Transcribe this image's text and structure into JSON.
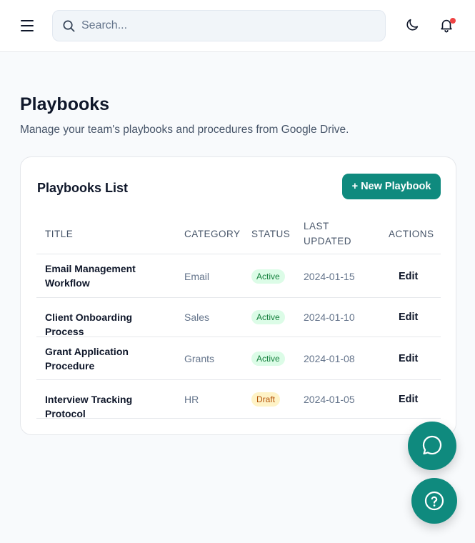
{
  "header": {
    "search_placeholder": "Search..."
  },
  "icons": {
    "menu": "menu-icon",
    "search": "search-icon",
    "theme": "moon-icon",
    "notifications": "bell-icon",
    "chat": "chat-bubble-icon",
    "help": "help-circle-icon"
  },
  "colors": {
    "accent": "#0f8a7e",
    "notification_dot": "#ef4444",
    "active_badge_bg": "#dcfce7",
    "active_badge_text": "#15803d",
    "draft_badge_bg": "#fef3c7",
    "draft_badge_text": "#b45309"
  },
  "page": {
    "title": "Playbooks",
    "subtitle": "Manage your team's playbooks and procedures from Google Drive."
  },
  "card": {
    "title": "Playbooks List",
    "new_button_label": "+ New Playbook"
  },
  "table": {
    "columns": {
      "title": "TITLE",
      "category": "CATEGORY",
      "status": "STATUS",
      "last_updated_line1": "LAST",
      "last_updated_line2": "UPDATED",
      "actions": "ACTIONS"
    },
    "rows": [
      {
        "title_line1": "Email Management",
        "title_line2": "Workflow",
        "category": "Email",
        "status": "Active",
        "date": "2024-01-15",
        "action": "Edit"
      },
      {
        "title_line1": "Client Onboarding Process",
        "title_line2": "",
        "category": "Sales",
        "status": "Active",
        "date": "2024-01-10",
        "action": "Edit"
      },
      {
        "title_line1": "Grant Application",
        "title_line2": "Procedure",
        "category": "Grants",
        "status": "Active",
        "date": "2024-01-08",
        "action": "Edit"
      },
      {
        "title_line1": "Interview Tracking Protocol",
        "title_line2": "",
        "category": "HR",
        "status": "Draft",
        "date": "2024-01-05",
        "action": "Edit"
      }
    ]
  }
}
